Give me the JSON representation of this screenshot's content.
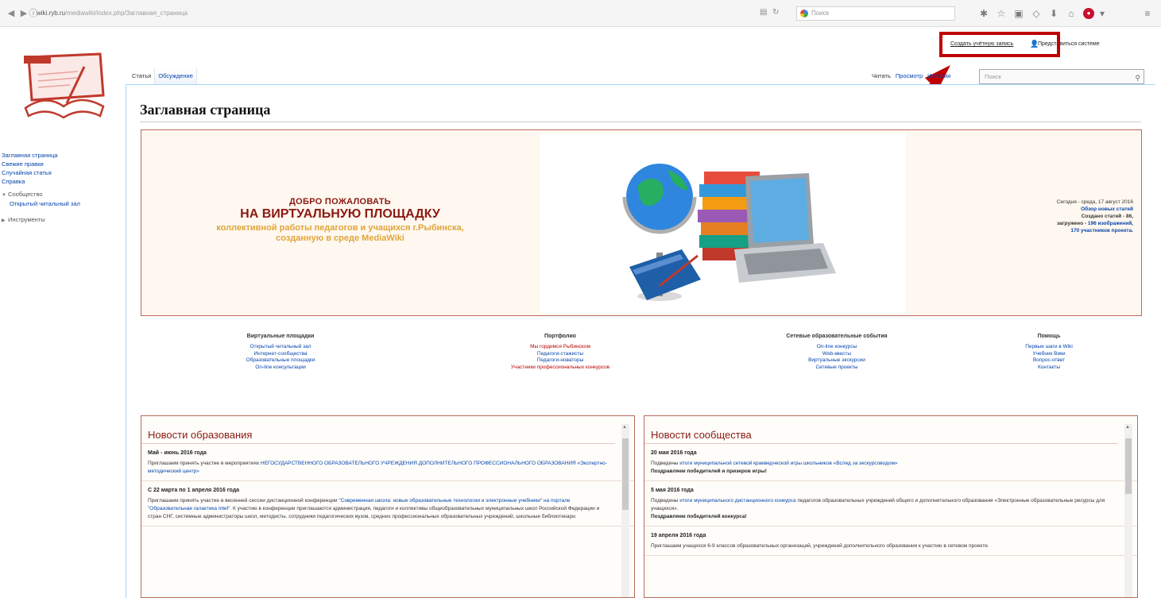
{
  "browser": {
    "url_domain": "wiki.ryb.ru",
    "url_path": "/mediawiki/index.php/Заглавная_страница",
    "search_placeholder": "Поиск"
  },
  "personal": {
    "create_account": "Создать учётную запись",
    "login": "Представиться системе"
  },
  "tabs": {
    "article": "Статья",
    "talk": "Обсуждение",
    "read": "Читать",
    "view_source": "Просмотр",
    "history": "История",
    "search_placeholder": "Поиск"
  },
  "sidebar": {
    "items": [
      "Заглавная страница",
      "Свежие правки",
      "Случайная статья",
      "Справка"
    ],
    "community_heading": "Сообщество",
    "community_items": [
      "Открытый читальный зал"
    ],
    "tools_heading": "Инструменты"
  },
  "page_title": "Заглавная страница",
  "banner": {
    "line1": "ДОБРО ПОЖАЛОВАТЬ",
    "line2": "НА ВИРТУАЛЬНУЮ ПЛОЩАДКУ",
    "line3": "коллективной работы педагогов и учащихся г.Рыбинска,",
    "line4": "созданную в среде MediaWiki",
    "stats_date": "Сегодня - среда, 17 август 2016",
    "stats_link": "Обзор новых статей",
    "stats_articles": "Создано статей - 86,",
    "stats_uploads_label": "загружено -",
    "stats_uploads_link": "196 изображений,",
    "stats_members_link": "170 участников проекта."
  },
  "columns": [
    {
      "heading": "Виртуальные площадки",
      "links": [
        "Открытый читальный зал",
        "Интернет-сообщества",
        "Образовательные площадки",
        "On-line консультации"
      ],
      "red": [
        false,
        false,
        false,
        false
      ]
    },
    {
      "heading": "Портфолио",
      "links": [
        "Мы гордимся Рыбинском",
        "Педагоги-стажисты",
        "Педагоги-новаторы",
        "Участники профессиональных конкурсов"
      ],
      "red": [
        true,
        false,
        false,
        true
      ]
    },
    {
      "heading": "Сетевые образовательные события",
      "links": [
        "On-line конкурсы",
        "Web-квесты",
        "Виртуальные экскурсии",
        "Сетевые проекты"
      ],
      "red": [
        false,
        false,
        false,
        false
      ]
    },
    {
      "heading": "Помощь",
      "links": [
        "Первые шаги в Wiki",
        "Учебник Вики",
        "Вопрос-ответ",
        "Контакты"
      ],
      "red": [
        false,
        false,
        false,
        false
      ]
    }
  ],
  "news_left": {
    "title": "Новости образования",
    "items": [
      {
        "date": "Май - июнь 2016 года",
        "pre": "Приглашаем принять участие в мероприятиях ",
        "link": "НЕГОСУДАРСТВЕННОГО ОБРАЗОВАТЕЛЬНОГО УЧРЕЖДЕНИЯ ДОПОЛНИТЕЛЬНОГО ПРОФЕССИОНАЛЬНОГО ОБРАЗОВАНИЯ «Экспертно-методический центр»",
        "post": ""
      },
      {
        "date": "С 22 марта по 1 апреля 2016 года",
        "pre": "Приглашаем принять участие в весенней сессии дистанционной конференции ",
        "link": "\"Современная школа: новые образовательные технологии и электронные учебники\" на портале \"Образовательная галактика Intel\"",
        "post": ". К участию в конференции приглашаются администрация, педагоги и коллективы общеобразовательных муниципальных школ Российской Федерации и стран СНГ, системные администраторы школ, методисты, сотрудники педагогических вузов, средних профессиональных образовательных учреждений, школьные библиотекари."
      }
    ]
  },
  "news_right": {
    "title": "Новости сообщества",
    "items": [
      {
        "date": "20 мая 2016 года",
        "pre": "Подведены ",
        "link": "итоги муниципальной сетевой краеведческой игры школьников «Вслед за экскурсоводом»",
        "bold": "Поздравляем победителей и призеров игры!"
      },
      {
        "date": "5 мая 2016 года",
        "pre": "Подведены ",
        "link": "итоги муниципального дистанционного конкурса",
        "mid": " педагогов образовательных учреждений общего и дополнительного образования «Электронные образовательные ресурсы для учащихся».",
        "bold": "Поздравляем победителей конкурса!"
      },
      {
        "date": "19 апреля 2016 года",
        "pre": "Приглашаем учащихся 6-9 классов образовательных организаций, учреждений дополнительного образования к участию в сетевом проекте.",
        "link": "",
        "bold": ""
      }
    ]
  },
  "colors": {
    "accent_red": "#8b1a12",
    "link_blue": "#0645ad",
    "highlight_red": "#c00000",
    "welcome_gold": "#e0a53a"
  }
}
